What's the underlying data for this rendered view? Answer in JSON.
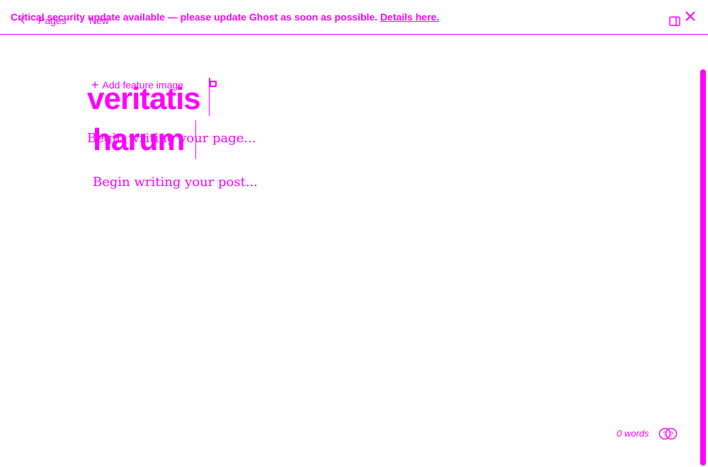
{
  "banner": {
    "message": "Critical security update available — please update Ghost as soon as possible.",
    "link_label": "Details here."
  },
  "nav": {
    "back_icon": "chevron-left-icon",
    "breadcrumb_label": "Pages",
    "status_label": "New"
  },
  "toolbar": {
    "sidebar_icon": "sidebar-toggle-icon",
    "close_icon": "close-icon"
  },
  "editor": {
    "add_feature_label": "Add feature image",
    "title_lines": [
      "veritatis",
      "harum"
    ],
    "page_body_placeholder": "Begin writing your page...",
    "post_body_placeholder": "Begin writing your post..."
  },
  "footer": {
    "word_count": "0 words",
    "help_icon": "help-icon"
  },
  "colors": {
    "accent": "#ff00ff"
  }
}
